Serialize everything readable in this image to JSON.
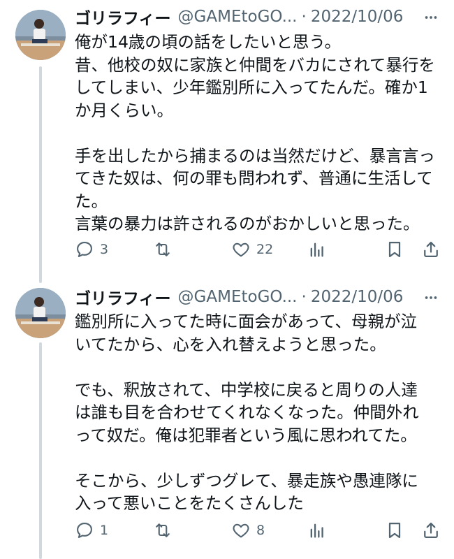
{
  "tweets": [
    {
      "display_name": "ゴリラフィー",
      "handle": "@GAMEtoGO...",
      "separator": "·",
      "date": "2022/10/06",
      "lines": [
        "俺が14歳の頃の話をしたいと思う。",
        "昔、他校の奴に家族と仲間をバカにされて暴行を",
        "してしまい、少年鑑別所に入ってたんだ。確か1",
        "か月くらい。",
        "",
        "手を出したから捕まるのは当然だけど、暴言言っ",
        "てきた奴は、何の罪も問われず、普通に生活して",
        "た。",
        "言葉の暴力は許されるのがおかしいと思った。"
      ],
      "reply_count": "3",
      "retweet_count": "",
      "like_count": "22"
    },
    {
      "display_name": "ゴリラフィー",
      "handle": "@GAMEtoGO...",
      "separator": "·",
      "date": "2022/10/06",
      "lines": [
        "鑑別所に入ってた時に面会があって、母親が泣",
        "いてたから、心を入れ替えようと思った。",
        "",
        "でも、釈放されて、中学校に戻ると周りの人達",
        "は誰も目を合わせてくれなくなった。仲間外れ",
        "って奴だ。俺は犯罪者という風に思われてた。",
        "",
        "そこから、少しずつグレて、暴走族や愚連隊に",
        "入って悪いことをたくさんした"
      ],
      "reply_count": "1",
      "retweet_count": "",
      "like_count": "8"
    }
  ],
  "icons": {
    "more": "more-horizontal-icon",
    "reply": "reply-icon",
    "retweet": "retweet-icon",
    "like": "heart-icon",
    "views": "analytics-icon",
    "bookmark": "bookmark-icon",
    "share": "share-icon"
  },
  "colors": {
    "text": "#0f1419",
    "secondary": "#536471",
    "thread_line": "#cfd9de"
  }
}
